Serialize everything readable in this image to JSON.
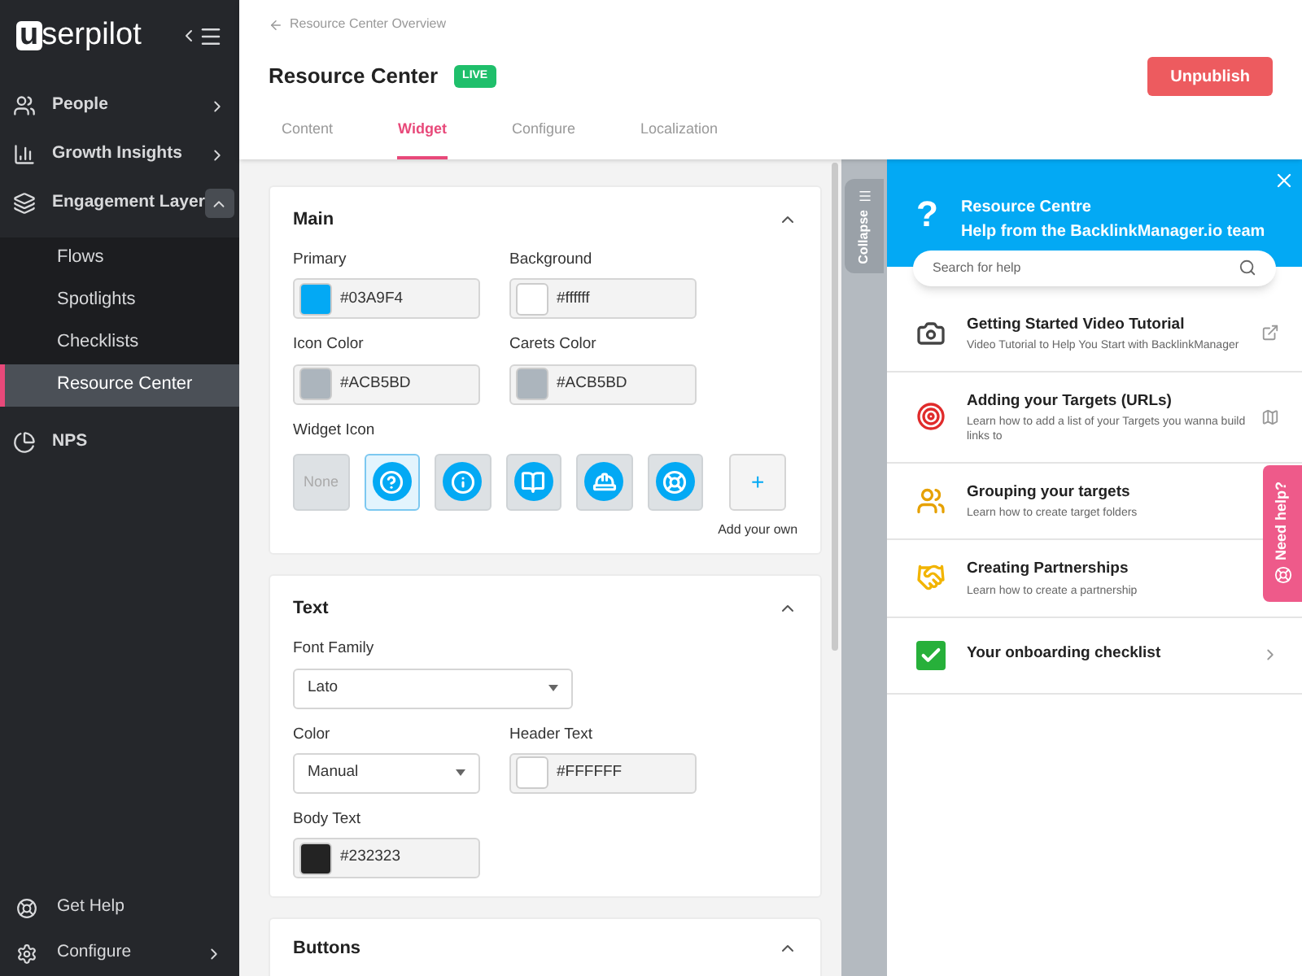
{
  "sidebar": {
    "logo_mark": "u",
    "logo_text": "serpilot",
    "items": [
      {
        "kind": "people",
        "label": "People"
      },
      {
        "kind": "chart",
        "label": "Growth Insights"
      },
      {
        "kind": "layers",
        "label": "Engagement Layer",
        "expanded": true,
        "children": [
          {
            "label": "Flows",
            "selected": false
          },
          {
            "label": "Spotlights",
            "selected": false
          },
          {
            "label": "Checklists",
            "selected": false
          },
          {
            "label": "Resource Center",
            "selected": true
          }
        ]
      },
      {
        "kind": "nps",
        "label": "NPS"
      }
    ],
    "bottom": [
      {
        "kind": "help",
        "label": "Get Help",
        "arrow": false
      },
      {
        "kind": "gear",
        "label": "Configure",
        "arrow": true
      }
    ]
  },
  "header": {
    "back_link": "Resource Center Overview",
    "title": "Resource Center",
    "badge": "LIVE",
    "action": "Unpublish",
    "tabs": [
      {
        "label": "Content",
        "selected": false
      },
      {
        "label": "Widget",
        "selected": true
      },
      {
        "label": "Configure",
        "selected": false
      },
      {
        "label": "Localization",
        "selected": false
      }
    ]
  },
  "main_card": {
    "title": "Main",
    "colors": [
      {
        "label": "Primary",
        "value": "#03A9F4"
      },
      {
        "label": "Background",
        "value": "#ffffff"
      },
      {
        "label": "Icon Color",
        "value": "#ACB5BD"
      },
      {
        "label": "Carets Color",
        "value": "#ACB5BD"
      }
    ],
    "widget_icon_label": "Widget Icon",
    "widget_icons": [
      {
        "kind": "none",
        "text": "None",
        "selected": false
      },
      {
        "kind": "question",
        "selected": true
      },
      {
        "kind": "info",
        "selected": false
      },
      {
        "kind": "book",
        "selected": false
      },
      {
        "kind": "helmet",
        "selected": false
      },
      {
        "kind": "lifebuoy",
        "selected": false
      },
      {
        "kind": "add",
        "text": "+",
        "caption": "Add your own",
        "selected": false
      }
    ]
  },
  "text_card": {
    "title": "Text",
    "font_family_label": "Font Family",
    "font_family": "Lato",
    "color_label": "Color",
    "color_mode": "Manual",
    "header_text_label": "Header Text",
    "header_text": "#FFFFFF",
    "body_text_label": "Body Text",
    "body_text": "#232323"
  },
  "buttons_card": {
    "title": "Buttons"
  },
  "collapse_tab": "Collapse",
  "preview": {
    "icon_text": "?",
    "title": "Resource Centre",
    "subtitle": "Help from the BacklinkManager.io team",
    "search_placeholder": "Search for help",
    "items": [
      {
        "kind": "video",
        "title": "Getting Started Video Tutorial",
        "description": "Video Tutorial to Help You Start with BacklinkManager"
      },
      {
        "kind": "article",
        "title": "Adding your Targets (URLs)",
        "description": "Learn how to add a list of your Targets you wanna build links to"
      },
      {
        "kind": "grouping",
        "title": "Grouping your targets",
        "description": "Learn how to create target folders"
      },
      {
        "kind": "partnership",
        "title": "Creating Partnerships",
        "description": "Learn how to create a partnership"
      },
      {
        "kind": "checklist",
        "title": "Your onboarding checklist"
      }
    ]
  },
  "need_help": "Need help?"
}
